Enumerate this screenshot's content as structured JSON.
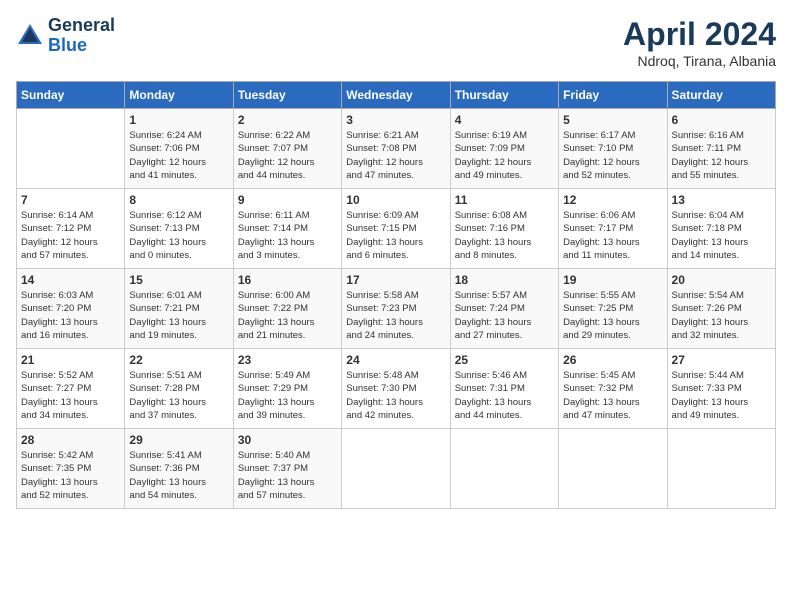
{
  "header": {
    "logo": {
      "general": "General",
      "blue": "Blue"
    },
    "title": "April 2024",
    "location": "Ndroq, Tirana, Albania"
  },
  "weekdays": [
    "Sunday",
    "Monday",
    "Tuesday",
    "Wednesday",
    "Thursday",
    "Friday",
    "Saturday"
  ],
  "weeks": [
    [
      {
        "day": "",
        "info": ""
      },
      {
        "day": "1",
        "info": "Sunrise: 6:24 AM\nSunset: 7:06 PM\nDaylight: 12 hours\nand 41 minutes."
      },
      {
        "day": "2",
        "info": "Sunrise: 6:22 AM\nSunset: 7:07 PM\nDaylight: 12 hours\nand 44 minutes."
      },
      {
        "day": "3",
        "info": "Sunrise: 6:21 AM\nSunset: 7:08 PM\nDaylight: 12 hours\nand 47 minutes."
      },
      {
        "day": "4",
        "info": "Sunrise: 6:19 AM\nSunset: 7:09 PM\nDaylight: 12 hours\nand 49 minutes."
      },
      {
        "day": "5",
        "info": "Sunrise: 6:17 AM\nSunset: 7:10 PM\nDaylight: 12 hours\nand 52 minutes."
      },
      {
        "day": "6",
        "info": "Sunrise: 6:16 AM\nSunset: 7:11 PM\nDaylight: 12 hours\nand 55 minutes."
      }
    ],
    [
      {
        "day": "7",
        "info": "Sunrise: 6:14 AM\nSunset: 7:12 PM\nDaylight: 12 hours\nand 57 minutes."
      },
      {
        "day": "8",
        "info": "Sunrise: 6:12 AM\nSunset: 7:13 PM\nDaylight: 13 hours\nand 0 minutes."
      },
      {
        "day": "9",
        "info": "Sunrise: 6:11 AM\nSunset: 7:14 PM\nDaylight: 13 hours\nand 3 minutes."
      },
      {
        "day": "10",
        "info": "Sunrise: 6:09 AM\nSunset: 7:15 PM\nDaylight: 13 hours\nand 6 minutes."
      },
      {
        "day": "11",
        "info": "Sunrise: 6:08 AM\nSunset: 7:16 PM\nDaylight: 13 hours\nand 8 minutes."
      },
      {
        "day": "12",
        "info": "Sunrise: 6:06 AM\nSunset: 7:17 PM\nDaylight: 13 hours\nand 11 minutes."
      },
      {
        "day": "13",
        "info": "Sunrise: 6:04 AM\nSunset: 7:18 PM\nDaylight: 13 hours\nand 14 minutes."
      }
    ],
    [
      {
        "day": "14",
        "info": "Sunrise: 6:03 AM\nSunset: 7:20 PM\nDaylight: 13 hours\nand 16 minutes."
      },
      {
        "day": "15",
        "info": "Sunrise: 6:01 AM\nSunset: 7:21 PM\nDaylight: 13 hours\nand 19 minutes."
      },
      {
        "day": "16",
        "info": "Sunrise: 6:00 AM\nSunset: 7:22 PM\nDaylight: 13 hours\nand 21 minutes."
      },
      {
        "day": "17",
        "info": "Sunrise: 5:58 AM\nSunset: 7:23 PM\nDaylight: 13 hours\nand 24 minutes."
      },
      {
        "day": "18",
        "info": "Sunrise: 5:57 AM\nSunset: 7:24 PM\nDaylight: 13 hours\nand 27 minutes."
      },
      {
        "day": "19",
        "info": "Sunrise: 5:55 AM\nSunset: 7:25 PM\nDaylight: 13 hours\nand 29 minutes."
      },
      {
        "day": "20",
        "info": "Sunrise: 5:54 AM\nSunset: 7:26 PM\nDaylight: 13 hours\nand 32 minutes."
      }
    ],
    [
      {
        "day": "21",
        "info": "Sunrise: 5:52 AM\nSunset: 7:27 PM\nDaylight: 13 hours\nand 34 minutes."
      },
      {
        "day": "22",
        "info": "Sunrise: 5:51 AM\nSunset: 7:28 PM\nDaylight: 13 hours\nand 37 minutes."
      },
      {
        "day": "23",
        "info": "Sunrise: 5:49 AM\nSunset: 7:29 PM\nDaylight: 13 hours\nand 39 minutes."
      },
      {
        "day": "24",
        "info": "Sunrise: 5:48 AM\nSunset: 7:30 PM\nDaylight: 13 hours\nand 42 minutes."
      },
      {
        "day": "25",
        "info": "Sunrise: 5:46 AM\nSunset: 7:31 PM\nDaylight: 13 hours\nand 44 minutes."
      },
      {
        "day": "26",
        "info": "Sunrise: 5:45 AM\nSunset: 7:32 PM\nDaylight: 13 hours\nand 47 minutes."
      },
      {
        "day": "27",
        "info": "Sunrise: 5:44 AM\nSunset: 7:33 PM\nDaylight: 13 hours\nand 49 minutes."
      }
    ],
    [
      {
        "day": "28",
        "info": "Sunrise: 5:42 AM\nSunset: 7:35 PM\nDaylight: 13 hours\nand 52 minutes."
      },
      {
        "day": "29",
        "info": "Sunrise: 5:41 AM\nSunset: 7:36 PM\nDaylight: 13 hours\nand 54 minutes."
      },
      {
        "day": "30",
        "info": "Sunrise: 5:40 AM\nSunset: 7:37 PM\nDaylight: 13 hours\nand 57 minutes."
      },
      {
        "day": "",
        "info": ""
      },
      {
        "day": "",
        "info": ""
      },
      {
        "day": "",
        "info": ""
      },
      {
        "day": "",
        "info": ""
      }
    ]
  ]
}
